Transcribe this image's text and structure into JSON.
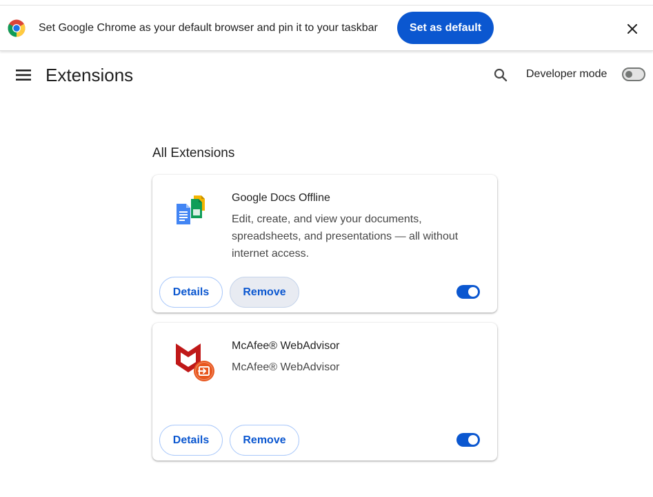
{
  "infobar": {
    "message": "Set Google Chrome as your default browser and pin it to your taskbar",
    "set_default_label": "Set as default"
  },
  "header": {
    "title": "Extensions",
    "developer_mode_label": "Developer mode",
    "developer_mode_on": false
  },
  "section_title": "All Extensions",
  "extensions": [
    {
      "name": "Google Docs Offline",
      "description": "Edit, create, and view your documents, spreadsheets, and presentations — all without internet access.",
      "details_label": "Details",
      "remove_label": "Remove",
      "enabled": true,
      "icon": "google-docs-offline-icon"
    },
    {
      "name": "McAfee® WebAdvisor",
      "description": "McAfee® WebAdvisor",
      "details_label": "Details",
      "remove_label": "Remove",
      "enabled": true,
      "icon": "mcafee-webadvisor-icon"
    }
  ],
  "colors": {
    "accent": "#0b57d0",
    "mcafee_red": "#c01818",
    "mcafee_orange": "#e8571f"
  }
}
